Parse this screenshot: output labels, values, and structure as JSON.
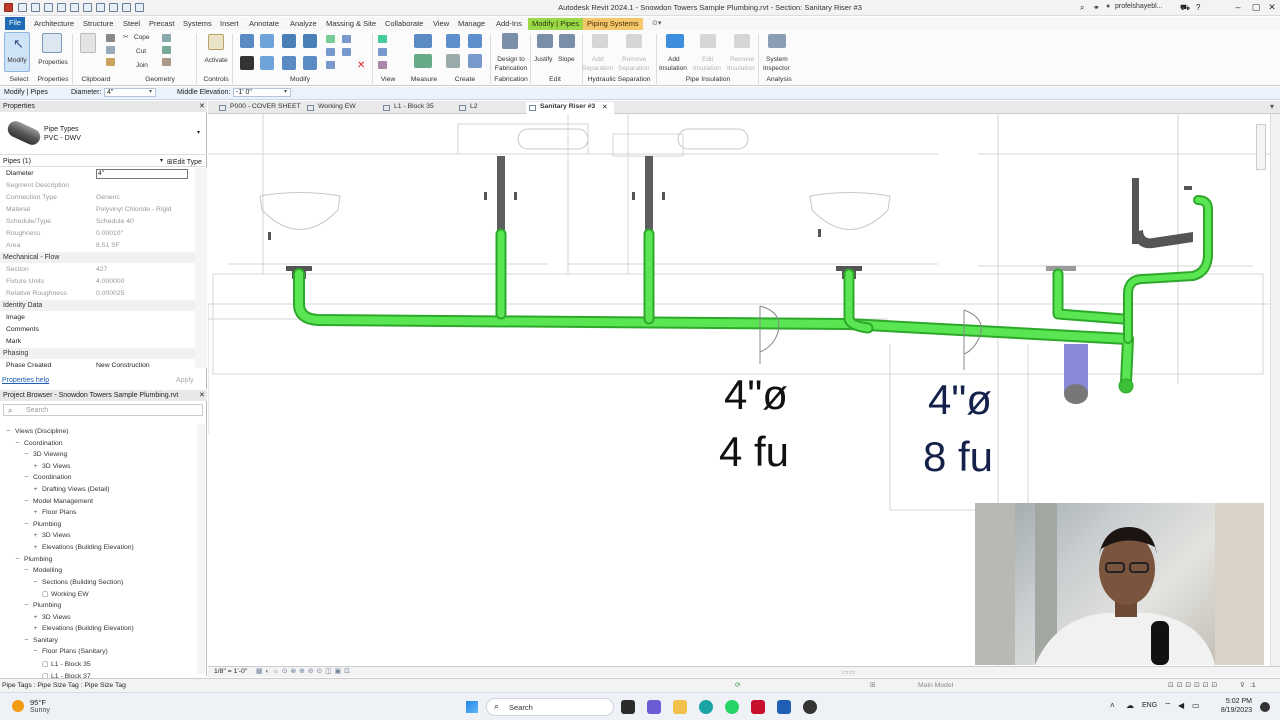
{
  "window": {
    "title": "Autodesk Revit 2024.1 - Snowdon Towers Sample Plumbing.rvt - Section: Sanitary Riser #3",
    "user": "profelshayebl..."
  },
  "ribbon_tabs": [
    "File",
    "Architecture",
    "Structure",
    "Steel",
    "Precast",
    "Systems",
    "Insert",
    "Annotate",
    "Analyze",
    "Massing & Site",
    "Collaborate",
    "View",
    "Manage",
    "Add-Ins",
    "Modify | Pipes",
    "Piping Systems"
  ],
  "ribbon": {
    "select": {
      "modify": "Modify",
      "select": "Select"
    },
    "properties": "Properties",
    "clipboard": {
      "title": "Clipboard",
      "cope": "Cope",
      "cut": "Cut",
      "join": "Join"
    },
    "geometry": "Geometry",
    "controls": {
      "title": "Controls",
      "activate": "Activate"
    },
    "modify": "Modify",
    "view": "View",
    "measure": "Measure",
    "create": "Create",
    "fabrication": {
      "title": "Fabrication",
      "design_to": "Design to",
      "fabrication": "Fabrication"
    },
    "edit": {
      "title": "Edit",
      "justify": "Justify",
      "slope": "Slope"
    },
    "hydraulic": {
      "title": "Hydraulic Separation",
      "add": "Add",
      "separation": "Separation",
      "remove": "Remove",
      "separation2": "Separation"
    },
    "insulation": {
      "title": "Pipe Insulation",
      "add": "Add",
      "insulation": "Insulation",
      "edit": "Edit",
      "insulation2": "Insulation",
      "remove": "Remove",
      "insulation3": "Insulation"
    },
    "analysis": {
      "title": "Analysis",
      "system": "System",
      "inspector": "Inspector"
    }
  },
  "options_bar": {
    "context": "Modify | Pipes",
    "diameter_label": "Diameter:",
    "diameter_value": "4\"",
    "middle_elevation_label": "Middle Elevation:",
    "middle_elevation_value": "-1' 0\""
  },
  "view_tabs": [
    "P000 - COVER SHEET",
    "Working EW",
    "L1 - Block 35",
    "L2",
    "Sanitary Riser #3"
  ],
  "properties": {
    "header": "Properties",
    "type_family": "Pipe Types",
    "type_name": "PVC - DWV",
    "selector": "Pipes (1)",
    "edit_type": "Edit Type",
    "rows": [
      {
        "k": "Diameter",
        "v": "4\""
      },
      {
        "k": "Segment Description",
        "v": ""
      },
      {
        "k": "Connection Type",
        "v": "Generic"
      },
      {
        "k": "Material",
        "v": "Polyvinyl Chloride - Rigid"
      },
      {
        "k": "Schedule/Type",
        "v": "Schedule 40"
      },
      {
        "k": "Roughness",
        "v": "0.00010\""
      },
      {
        "k": "Area",
        "v": "8.51 SF"
      }
    ],
    "group_flow": "Mechanical - Flow",
    "flow_rows": [
      {
        "k": "Section",
        "v": "427"
      },
      {
        "k": "Fixture Units",
        "v": "4.000000"
      },
      {
        "k": "Relative Roughness",
        "v": "0.000025"
      }
    ],
    "group_identity": "Identity Data",
    "identity_rows": [
      {
        "k": "Image",
        "v": ""
      },
      {
        "k": "Comments",
        "v": ""
      },
      {
        "k": "Mark",
        "v": ""
      }
    ],
    "group_phasing": "Phasing",
    "phasing_rows": [
      {
        "k": "Phase Created",
        "v": "New Construction"
      }
    ],
    "help": "Properties help",
    "apply": "Apply"
  },
  "browser": {
    "header": "Project Browser - Snowdon Towers Sample Plumbing.rvt",
    "search": "Search",
    "tree": [
      {
        "label": "Views (Discipline)",
        "d": 0,
        "t": "-"
      },
      {
        "label": "Coordination",
        "d": 1,
        "t": "-"
      },
      {
        "label": "3D Viewing",
        "d": 2,
        "t": "-"
      },
      {
        "label": "3D Views",
        "d": 3,
        "t": "+"
      },
      {
        "label": "Coordination",
        "d": 2,
        "t": "-"
      },
      {
        "label": "Drafting Views (Detail)",
        "d": 3,
        "t": "+"
      },
      {
        "label": "Model Management",
        "d": 2,
        "t": "-"
      },
      {
        "label": "Floor Plans",
        "d": 3,
        "t": "+"
      },
      {
        "label": "Plumbing",
        "d": 2,
        "t": "-"
      },
      {
        "label": "3D Views",
        "d": 3,
        "t": "+"
      },
      {
        "label": "Elevations (Building Elevation)",
        "d": 3,
        "t": "+"
      },
      {
        "label": "Plumbing",
        "d": 1,
        "t": "-"
      },
      {
        "label": "Modelling",
        "d": 2,
        "t": "-"
      },
      {
        "label": "Sections (Building Section)",
        "d": 3,
        "t": "-"
      },
      {
        "label": "Working EW",
        "d": 4,
        "t": ""
      },
      {
        "label": "Plumbing",
        "d": 2,
        "t": "-"
      },
      {
        "label": "3D Views",
        "d": 3,
        "t": "+"
      },
      {
        "label": "Elevations (Building Elevation)",
        "d": 3,
        "t": "+"
      },
      {
        "label": "Sanitary",
        "d": 2,
        "t": "-"
      },
      {
        "label": "Floor Plans (Sanitary)",
        "d": 3,
        "t": "-"
      },
      {
        "label": "L1 - Block 35",
        "d": 4,
        "t": ""
      },
      {
        "label": "L1 - Block 37",
        "d": 4,
        "t": ""
      }
    ]
  },
  "annotations": [
    {
      "size": "4\"ø",
      "fu": "4 fu"
    },
    {
      "size": "4\"ø",
      "fu": "8 fu"
    }
  ],
  "view_bar": {
    "scale": "1/8\" = 1'-0\""
  },
  "status_bar": {
    "text": "Pipe Tags : Pipe Size Tag : Pipe Size Tag",
    "model": "Main Model",
    "filter": ":1"
  },
  "taskbar": {
    "weather_temp": "95°F",
    "weather_desc": "Sunny",
    "search": "Search",
    "lang": "ENG",
    "time": "5:02 PM",
    "date": "8/19/2023"
  },
  "colors": {
    "pipe": "#52e04c",
    "pipe_dark": "#2fb02a",
    "ctx_tab": "#9bd94a",
    "file_tab": "#1e6bb8"
  }
}
